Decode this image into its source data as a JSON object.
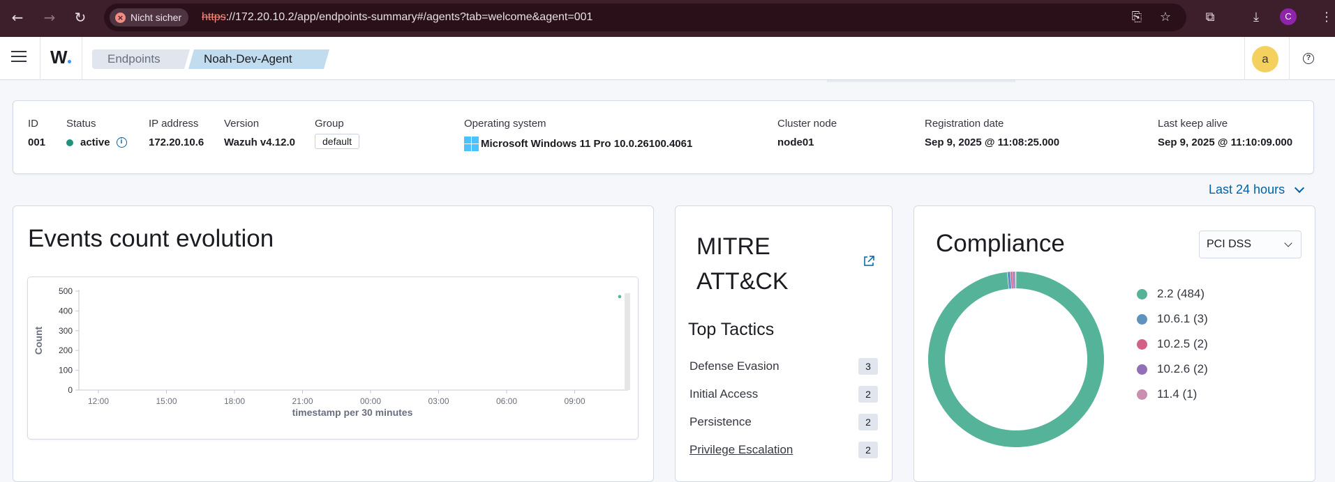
{
  "browser": {
    "insecure_label": "Nicht sicher",
    "url_scheme": "https",
    "url_rest": "://172.20.10.2/app/endpoints-summary#/agents?tab=welcome&agent=001",
    "profile_initial": "C"
  },
  "header": {
    "logo_text": "W",
    "breadcrumbs": [
      "Endpoints",
      "Noah-Dev-Agent"
    ],
    "avatar_initial": "a",
    "help_glyph": "?"
  },
  "agent": {
    "id_label": "ID",
    "id": "001",
    "status_label": "Status",
    "status": "active",
    "ip_label": "IP address",
    "ip": "172.20.10.6",
    "version_label": "Version",
    "version": "Wazuh v4.12.0",
    "group_label": "Group",
    "group": "default",
    "os_label": "Operating system",
    "os": "Microsoft Windows 11 Pro 10.0.26100.4061",
    "cluster_label": "Cluster node",
    "cluster": "node01",
    "registration_label": "Registration date",
    "registration": "Sep 9, 2025 @ 11:08:25.000",
    "keepalive_label": "Last keep alive",
    "keepalive": "Sep 9, 2025 @ 11:10:09.000"
  },
  "time_picker": {
    "label": "Last 24 hours"
  },
  "events": {
    "title": "Events count evolution",
    "chart_data": {
      "type": "bar",
      "title": "Events count evolution",
      "xlabel": "timestamp per 30 minutes",
      "ylabel": "Count",
      "ylim": [
        0,
        500
      ],
      "yticks": [
        0,
        100,
        200,
        300,
        400,
        500
      ],
      "xticks": [
        "12:00",
        "15:00",
        "18:00",
        "21:00",
        "00:00",
        "03:00",
        "06:00",
        "09:00"
      ],
      "x": [
        "11:00"
      ],
      "values": [
        490
      ],
      "color": "#54b399"
    }
  },
  "mitre": {
    "title": "MITRE ATT&CK",
    "tactics_title": "Top Tactics",
    "tactics": [
      {
        "name": "Defense Evasion",
        "count": "3"
      },
      {
        "name": "Initial Access",
        "count": "2"
      },
      {
        "name": "Persistence",
        "count": "2"
      },
      {
        "name": "Privilege Escalation",
        "count": "2"
      }
    ]
  },
  "compliance": {
    "title": "Compliance",
    "selected_standard": "PCI DSS",
    "chart_data": {
      "type": "pie",
      "donut": true,
      "categories": [
        "2.2",
        "10.6.1",
        "10.2.5",
        "10.2.6",
        "11.4"
      ],
      "values": [
        484,
        3,
        2,
        2,
        1
      ],
      "colors": [
        "#54b399",
        "#6092c0",
        "#d36086",
        "#9170b8",
        "#ca8eae"
      ]
    },
    "legend": [
      "2.2 (484)",
      "10.6.1 (3)",
      "10.2.5 (2)",
      "10.2.6 (2)",
      "11.4 (1)"
    ]
  }
}
